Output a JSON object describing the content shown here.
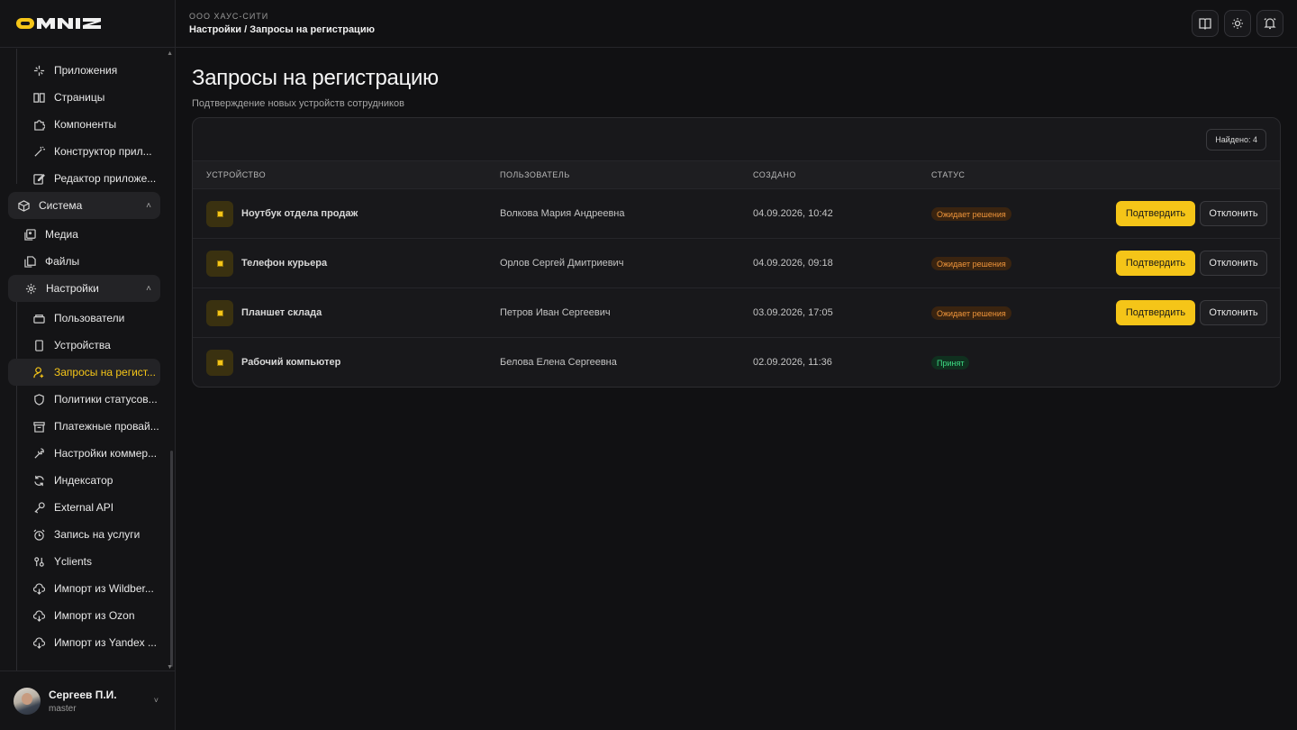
{
  "brand": {
    "name": "OMNIZ",
    "accent": "#f5c518"
  },
  "header": {
    "org": "ООО ХАУС-СИТИ",
    "breadcrumb": "Настройки / Запросы на регистрацию",
    "buttons": [
      "book-icon",
      "sun-icon",
      "bell-icon"
    ]
  },
  "sidebar": {
    "items": [
      {
        "label": "Приложения",
        "icon": "sparkles-icon"
      },
      {
        "label": "Страницы",
        "icon": "book-icon"
      },
      {
        "label": "Компоненты",
        "icon": "puzzle-icon"
      },
      {
        "label": "Конструктор прил...",
        "icon": "wand-icon"
      },
      {
        "label": "Редактор приложе...",
        "icon": "edit-icon"
      },
      {
        "label": "Система",
        "icon": "cube-icon",
        "group": true
      },
      {
        "label": "Медиа",
        "icon": "images-icon"
      },
      {
        "label": "Файлы",
        "icon": "files-icon"
      },
      {
        "label": "Настройки",
        "icon": "gear-icon",
        "group": true
      },
      {
        "label": "Пользователи",
        "icon": "users-box-icon"
      },
      {
        "label": "Устройства",
        "icon": "device-icon"
      },
      {
        "label": "Запросы на регист...",
        "icon": "user-plus-icon",
        "active": true
      },
      {
        "label": "Политики статусов...",
        "icon": "shield-icon"
      },
      {
        "label": "Платежные провай...",
        "icon": "archive-icon"
      },
      {
        "label": "Настройки коммер...",
        "icon": "wrench-icon"
      },
      {
        "label": "Индексатор",
        "icon": "refresh-icon"
      },
      {
        "label": "External API",
        "icon": "key-icon"
      },
      {
        "label": "Запись на услуги",
        "icon": "alarm-icon"
      },
      {
        "label": "Yclients",
        "icon": "switch-icon"
      },
      {
        "label": "Импорт из Wildber...",
        "icon": "cloud-download-icon"
      },
      {
        "label": "Импорт из Ozon",
        "icon": "cloud-download-icon"
      },
      {
        "label": "Импорт из Yandex ...",
        "icon": "cloud-download-icon"
      }
    ],
    "user": {
      "name": "Сергеев П.И.",
      "role": "master"
    }
  },
  "main": {
    "title": "Запросы на регистрацию",
    "subtitle": "Подтверждение новых устройств сотрудников",
    "found": "Найдено: 4",
    "columns": [
      "УСТРОЙСТВО",
      "ПОЛЬЗОВАТЕЛЬ",
      "СОЗДАНО",
      "СТАТУС"
    ],
    "rows": [
      {
        "device": "Ноутбук отдела продаж",
        "user": "Волкова Мария Андреевна",
        "created": "04.09.2026, 10:42",
        "status": "Ожидает решения",
        "status_type": "pending",
        "confirm": "Подтвердить",
        "reject": "Отклонить"
      },
      {
        "device": "Телефон курьера",
        "user": "Орлов Сергей Дмитриевич",
        "created": "04.09.2026, 09:18",
        "status": "Ожидает решения",
        "status_type": "pending",
        "confirm": "Подтвердить",
        "reject": "Отклонить"
      },
      {
        "device": "Планшет склада",
        "user": "Петров Иван Сергеевич",
        "created": "03.09.2026, 17:05",
        "status": "Ожидает решения",
        "status_type": "pending",
        "confirm": "Подтвердить",
        "reject": "Отклонить"
      },
      {
        "device": "Рабочий компьютер",
        "user": "Белова Елена Сергеевна",
        "created": "02.09.2026, 11:36",
        "status": "Принят",
        "status_type": "accepted"
      }
    ]
  }
}
